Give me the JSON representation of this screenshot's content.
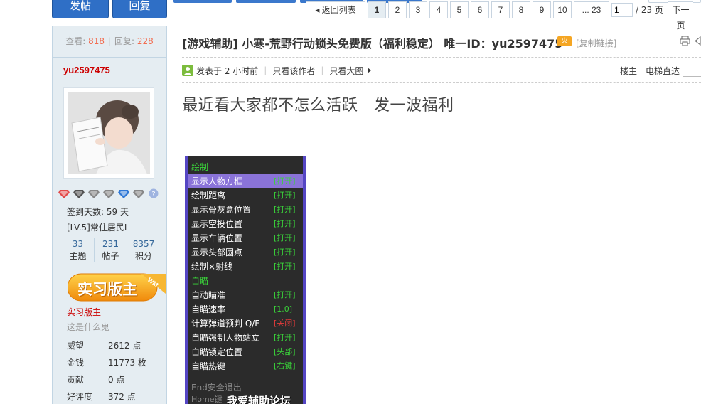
{
  "toolbar": {
    "post_label": "发帖",
    "reply_label": "回复"
  },
  "pager": {
    "back_label": "返回列表",
    "pages": [
      "1",
      "2",
      "3",
      "4",
      "5",
      "6",
      "7",
      "8",
      "9",
      "10"
    ],
    "ellipsis_label": "... 23",
    "input_value": "1",
    "total_label": "/ 23 页",
    "next_label": "下一页"
  },
  "stats": {
    "views_label": "查看:",
    "views": "818",
    "replies_label": "回复:",
    "replies": "228"
  },
  "thread": {
    "title": "[游戏辅助] 小寒-荒野行动锁头免费版（福利稳定） 唯一ID：yu2597475",
    "hot_label": "火",
    "copy_link": "[复制链接]"
  },
  "postinfo": {
    "posted": "发表于 2 小时前",
    "author_only": "只看该作者",
    "big_image": "只看大图",
    "floor": "楼主",
    "elevator": "电梯直达"
  },
  "author": {
    "name": "yu2597475",
    "signin": "签到天数: 59 天",
    "level": "[LV.5]常住居民I",
    "counts": [
      {
        "num": "33",
        "label": "主题"
      },
      {
        "num": "231",
        "label": "帖子"
      },
      {
        "num": "8357",
        "label": "积分"
      }
    ],
    "badge_label": "实习版主",
    "badge_tag": "WM",
    "role": "实习版主",
    "group": "这是什么鬼",
    "props": [
      {
        "k": "威望",
        "v": "2612 点"
      },
      {
        "k": "金钱",
        "v": "11773 枚"
      },
      {
        "k": "贡献",
        "v": "0 点"
      },
      {
        "k": "好评度",
        "v": "372 点"
      }
    ]
  },
  "post": {
    "text": "最近看大家都不怎么活跃　发一波福利"
  },
  "menu": {
    "items": [
      {
        "label": "绘制",
        "status": "",
        "type": "head"
      },
      {
        "label": "显示人物方框",
        "status": "[打开]",
        "type": "hl"
      },
      {
        "label": "绘制距离",
        "status": "[打开]",
        "type": "item"
      },
      {
        "label": "显示骨灰盒位置",
        "status": "[打开]",
        "type": "item"
      },
      {
        "label": "显示空投位置",
        "status": "[打开]",
        "type": "item"
      },
      {
        "label": "显示车辆位置",
        "status": "[打开]",
        "type": "item"
      },
      {
        "label": "显示头部圆点",
        "status": "[打开]",
        "type": "item"
      },
      {
        "label": "绘制×射线",
        "status": "[打开]",
        "type": "item"
      },
      {
        "label": "自瞄",
        "status": "",
        "type": "head"
      },
      {
        "label": "自动瞄准",
        "status": "[打开]",
        "type": "item"
      },
      {
        "label": "自瞄速率",
        "status": "[1.0]",
        "type": "item"
      },
      {
        "label": "计算弹道预判 Q/E",
        "status": "[关闭]",
        "type": "red"
      },
      {
        "label": "自瞄强制人物站立",
        "status": "[打开]",
        "type": "item"
      },
      {
        "label": "自瞄锁定位置",
        "status": "[头部]",
        "type": "item"
      },
      {
        "label": "自瞄热键",
        "status": "[右键]",
        "type": "item"
      }
    ],
    "footer1": "End安全退出",
    "footer2": "Home键",
    "watermark": "我爱辅助论坛"
  },
  "colors": {
    "accent": "#2f6fc6",
    "menu_border": "#5546c4",
    "menu_green": "#3ad43a",
    "menu_red": "#e53b3b",
    "username": "#cc0000"
  }
}
